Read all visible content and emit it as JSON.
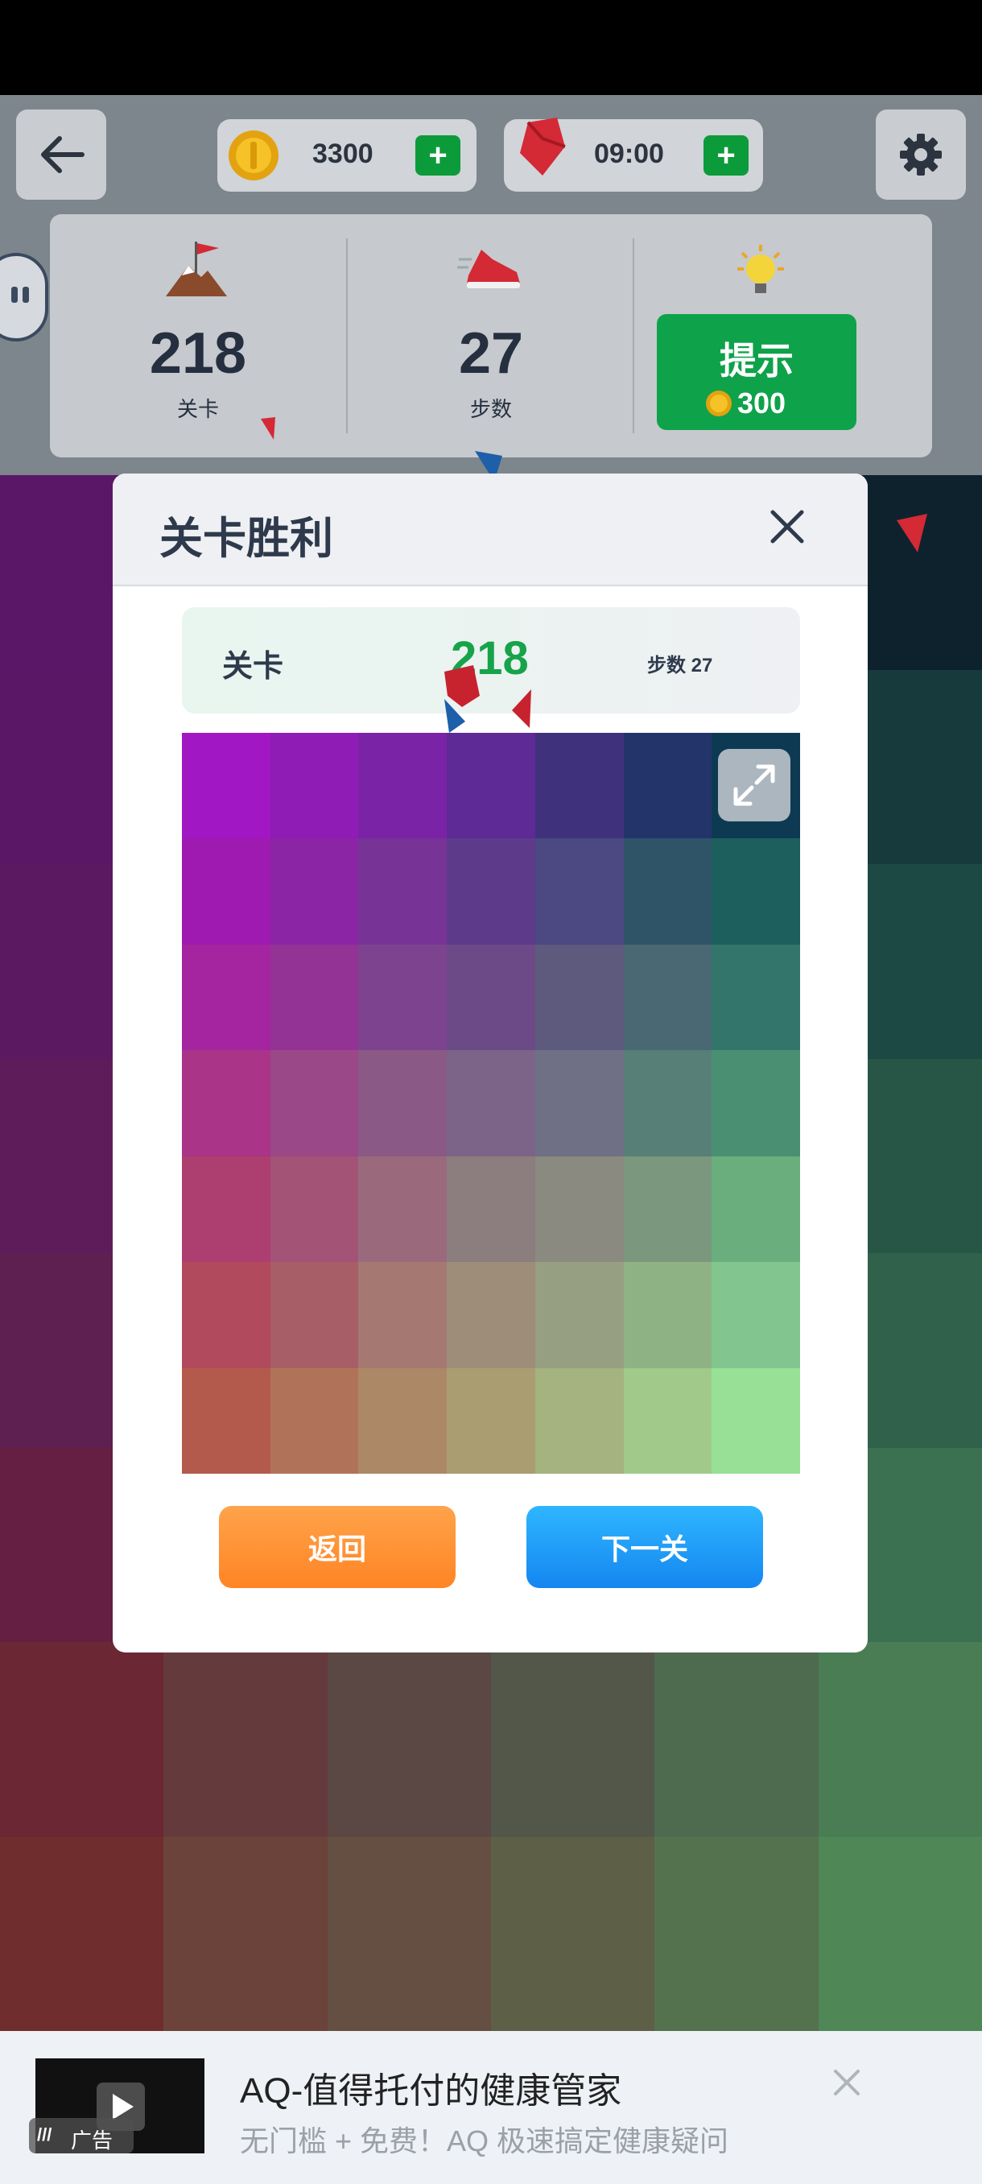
{
  "header": {
    "coins": "3300",
    "timer": "09:00",
    "stats": [
      {
        "value": "218",
        "label": "关卡"
      },
      {
        "value": "27",
        "label": "步数"
      }
    ],
    "hint": {
      "label": "提示",
      "cost": "300"
    }
  },
  "modal": {
    "title": "关卡胜利",
    "level_label": "关卡",
    "level_value": "218",
    "steps_text": "步数 27",
    "back_label": "返回",
    "next_label": "下一关",
    "grid_colors": [
      [
        "#a117c4",
        "#8f1cb5",
        "#7a23a6",
        "#5e2a96",
        "#40317d",
        "#22346a",
        "#0d3a52"
      ],
      [
        "#9f1ab0",
        "#8b25a5",
        "#783396",
        "#5e3b8a",
        "#4b4882",
        "#2f5468",
        "#1d5f5c"
      ],
      [
        "#a524a0",
        "#933396",
        "#7d438f",
        "#6b4a87",
        "#5e5a7d",
        "#4a6873",
        "#33756a"
      ],
      [
        "#aa3487",
        "#9a4888",
        "#8a5985",
        "#7b6487",
        "#6f7086",
        "#587e78",
        "#4b8f73"
      ],
      [
        "#ad3f70",
        "#a35376",
        "#9a6a7c",
        "#8c7d7e",
        "#8a8a80",
        "#7b977d",
        "#6aae7e"
      ],
      [
        "#b24a5e",
        "#a85e66",
        "#a57972",
        "#9e8d79",
        "#979f82",
        "#8fb285",
        "#82c58e"
      ],
      [
        "#b35a4c",
        "#b0735a",
        "#ad8866",
        "#ab9d72",
        "#a4b37f",
        "#a1ca8a",
        "#98e096"
      ]
    ]
  },
  "board_colors": [
    [
      "#5b1767",
      "#53195d",
      "#4b1b58",
      "#3c1e52",
      "#2d2147",
      "#0e222e"
    ],
    [
      "#5a1766",
      "#521c5c",
      "#471f57",
      "#37234f",
      "#2a2845",
      "#173a3c"
    ],
    [
      "#5b1961",
      "#53215c",
      "#49285a",
      "#3a2d55",
      "#2e3a4c",
      "#1c4943"
    ],
    [
      "#5e1d5a",
      "#57275a",
      "#4d3058",
      "#403b57",
      "#36494e",
      "#275647"
    ],
    [
      "#5e1f51",
      "#5a2c53",
      "#533957",
      "#444854",
      "#3c544d",
      "#2f614b"
    ],
    [
      "#641f43",
      "#5e3048",
      "#57404e",
      "#4d4f4e",
      "#40604d",
      "#3b7050"
    ],
    [
      "#6b2733",
      "#653a3c",
      "#5b4743",
      "#52574a",
      "#4e6b50",
      "#4b7d55"
    ],
    [
      "#6f2d2d",
      "#6b433a",
      "#644f42",
      "#5d6047",
      "#54724e",
      "#4f8757"
    ]
  ],
  "ad": {
    "title": "AQ-值得托付的健康管家",
    "subtitle": "无门槛 + 免费！AQ 极速搞定健康疑问",
    "badge": "广告"
  }
}
